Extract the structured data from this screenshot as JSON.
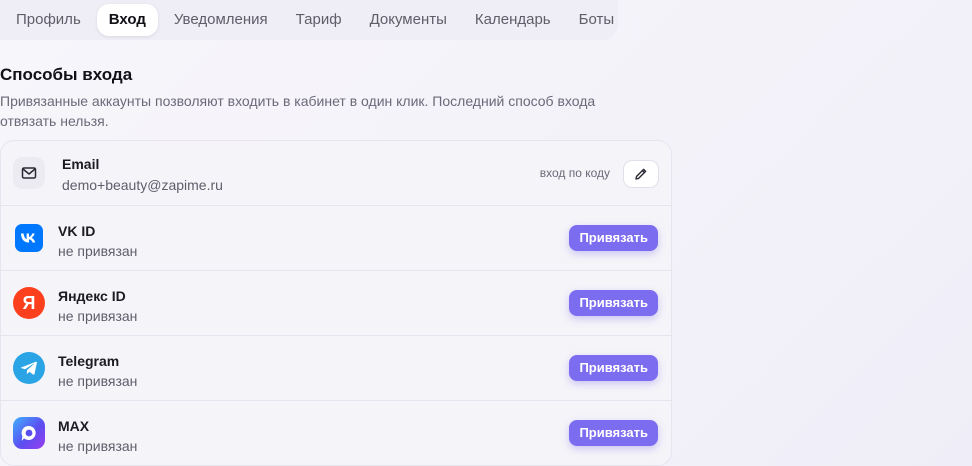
{
  "tabs": [
    {
      "label": "Профиль",
      "active": false
    },
    {
      "label": "Вход",
      "active": true
    },
    {
      "label": "Уведомления",
      "active": false
    },
    {
      "label": "Тариф",
      "active": false
    },
    {
      "label": "Документы",
      "active": false
    },
    {
      "label": "Календарь",
      "active": false
    },
    {
      "label": "Боты",
      "active": false
    }
  ],
  "section": {
    "title": "Способы входа",
    "description": "Привязанные аккаунты позволяют входить в кабинет в один клик. Последний способ входа отвязать нельзя."
  },
  "methods": {
    "email": {
      "name": "Email",
      "value": "demo+beauty@zapime.ru",
      "mode": "вход по коду",
      "icon": "mail-icon"
    },
    "vk": {
      "name": "VK ID",
      "status": "не привязан",
      "button": "Привязать",
      "icon": "vk-icon",
      "color": "#0077ff"
    },
    "yandex": {
      "name": "Яндекс ID",
      "status": "не привязан",
      "button": "Привязать",
      "icon": "yandex-icon",
      "color": "#fc3f1d"
    },
    "telegram": {
      "name": "Telegram",
      "status": "не привязан",
      "button": "Привязать",
      "icon": "telegram-icon",
      "color": "#2aa4e4"
    },
    "max": {
      "name": "MAX",
      "status": "не привязан",
      "button": "Привязать",
      "icon": "max-icon",
      "color": "#6a3cf0"
    }
  },
  "colors": {
    "accent": "#7b6cf0"
  }
}
